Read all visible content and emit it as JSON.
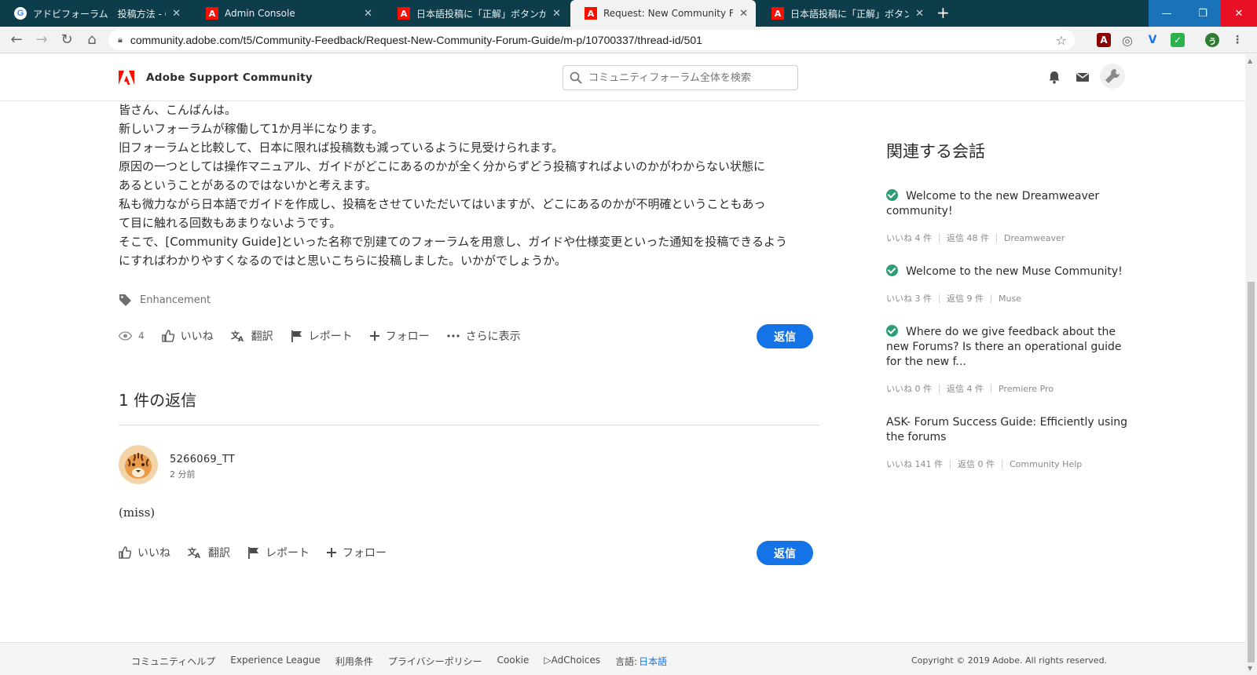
{
  "browser": {
    "tabs": [
      {
        "label": "アドビフォーラム　投稿方法 - Googl",
        "favicon": "google-icon"
      },
      {
        "label": "Admin Console",
        "favicon": "adobe-icon"
      },
      {
        "label": "日本語投稿に「正解」ボタンが見当た",
        "favicon": "adobe-icon"
      },
      {
        "label": "Request: New Community Forum",
        "favicon": "adobe-icon",
        "active": true
      },
      {
        "label": "日本語投稿に「正解」ボタンが見当た",
        "favicon": "adobe-icon"
      }
    ],
    "url": "community.adobe.com/t5/Community-Feedback/Request-New-Community-Forum-Guide/m-p/10700337/thread-id/501"
  },
  "site": {
    "brand": "Adobe Support Community",
    "search_placeholder": "コミュニティフォーラム全体を検索"
  },
  "post": {
    "lines": [
      "皆さん、こんばんは。",
      "新しいフォーラムが稼働して1か月半になります。",
      "旧フォーラムと比較して、日本に限れば投稿数も減っているように見受けられます。",
      "原因の一つとしては操作マニュアル、ガイドがどこにあるのかが全く分からずどう投稿すればよいのかがわからない状態に",
      "あるということがあるのではないかと考えます。",
      "私も微力ながら日本語でガイドを作成し、投稿をさせていただいてはいますが、どこにあるのかが不明確ということもあっ",
      "て目に触れる回数もあまりないようです。",
      "そこで、[Community Guide]といった名称で別建てのフォーラムを用意し、ガイドや仕様変更といった通知を投稿できるよう",
      "にすればわかりやすくなるのではと思いこちらに投稿しました。いかがでしょうか。"
    ],
    "tag": "Enhancement",
    "views": "4",
    "actions": {
      "like": "いいね",
      "translate": "翻訳",
      "report": "レポート",
      "follow": "フォロー",
      "more": "さらに表示",
      "reply": "返信"
    }
  },
  "replies": {
    "heading": "1 件の返信",
    "items": [
      {
        "user": "5266069_TT",
        "time": "2 分前",
        "text": "(miss)",
        "actions": {
          "like": "いいね",
          "translate": "翻訳",
          "report": "レポート",
          "follow": "フォロー",
          "reply": "返信"
        }
      }
    ]
  },
  "sidebar": {
    "title": "関連する会話",
    "conversations": [
      {
        "title": "Welcome to the new Dreamweaver community!",
        "solved": true,
        "likes": "いいね 4 件",
        "replies": "返信 48 件",
        "board": "Dreamweaver"
      },
      {
        "title": "Welcome to the new Muse Community!",
        "solved": true,
        "likes": "いいね 3 件",
        "replies": "返信 9 件",
        "board": "Muse"
      },
      {
        "title": "Where do we give feedback about the new Forums? Is there an operational guide for the new f...",
        "solved": true,
        "likes": "いいね 0 件",
        "replies": "返信 4 件",
        "board": "Premiere Pro"
      },
      {
        "title": "ASK- Forum Success Guide: Efficiently using the forums",
        "solved": false,
        "likes": "いいね 141 件",
        "replies": "返信 0 件",
        "board": "Community Help"
      }
    ]
  },
  "footer": {
    "links": [
      "コミュニティヘルプ",
      "Experience League",
      "利用条件",
      "プライバシーポリシー",
      "Cookie",
      "▷AdChoices"
    ],
    "language_label": "言語:",
    "language_value": "日本語",
    "copyright": "Copyright © 2019 Adobe. All rights reserved."
  },
  "colors": {
    "accent": "#1473e6",
    "adobe_red": "#fa0f00",
    "solved_green": "#2d9d78",
    "tabbar": "#0d3d4b"
  }
}
